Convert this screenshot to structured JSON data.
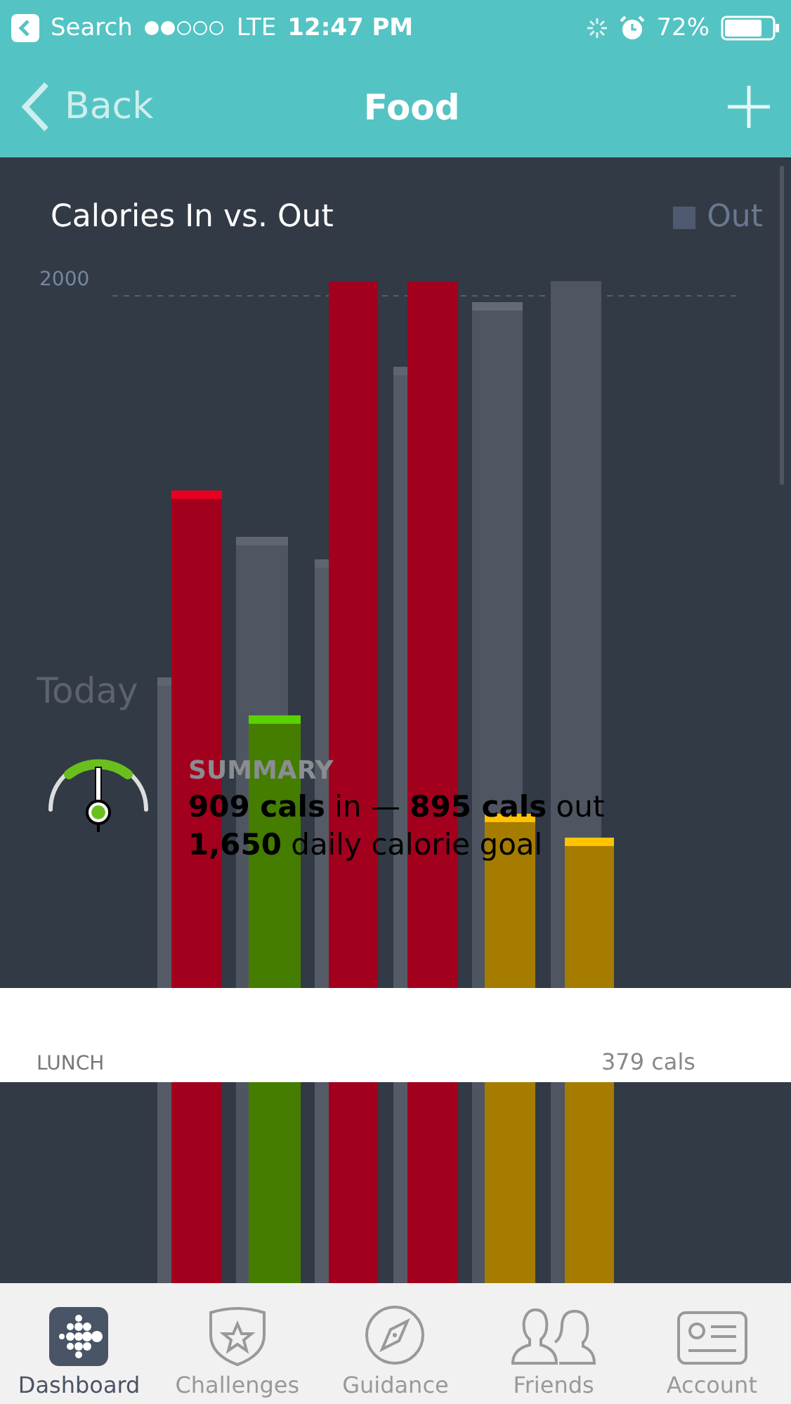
{
  "status_bar": {
    "back_label": "Search",
    "carrier": "LTE",
    "time": "12:47 PM",
    "battery": "72%"
  },
  "nav": {
    "back": "Back",
    "title": "Food"
  },
  "chart": {
    "title": "Calories In vs. Out",
    "legend": "Out",
    "tick": "2000",
    "day_label": "Today"
  },
  "summary": {
    "heading": "SUMMARY",
    "line1": "**909 cals** in — **895 cals** out",
    "line2": "**1,650** daily calorie goal"
  },
  "meal": {
    "name": "LUNCH",
    "calories": "379 cals"
  },
  "tabs": [
    {
      "label": "Dashboard",
      "selected": true
    },
    {
      "label": "Challenges",
      "selected": false
    },
    {
      "label": "Guidance",
      "selected": false
    },
    {
      "label": "Friends",
      "selected": false
    },
    {
      "label": "Account",
      "selected": false
    }
  ]
}
